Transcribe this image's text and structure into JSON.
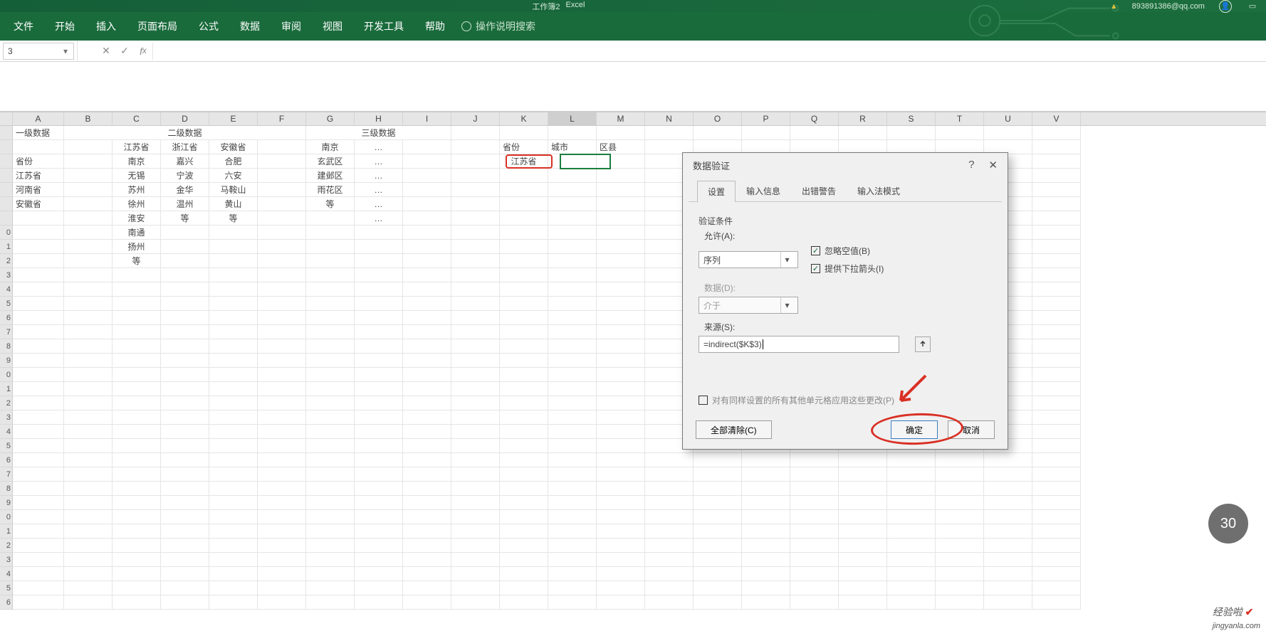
{
  "titlebar": {
    "center_1": "工作簿2",
    "center_2": "Excel",
    "email": "893891386@qq.com"
  },
  "ribbon": {
    "tabs": [
      "文件",
      "开始",
      "插入",
      "页面布局",
      "公式",
      "数据",
      "审阅",
      "视图",
      "开发工具",
      "帮助"
    ],
    "tellme": "操作说明搜索"
  },
  "fbar": {
    "namebox": "3",
    "formula": ""
  },
  "columns": [
    "A",
    "B",
    "C",
    "D",
    "E",
    "F",
    "G",
    "H",
    "I",
    "J",
    "K",
    "L",
    "M",
    "N",
    "O",
    "P",
    "Q",
    "R",
    "S",
    "T",
    "U",
    "V"
  ],
  "rows_numbers": [
    "",
    "",
    "",
    "",
    "",
    "",
    "",
    "0",
    "1",
    "2",
    "3",
    "4",
    "5",
    "6",
    "7",
    "8",
    "9",
    "0",
    "1",
    "2",
    "3",
    "4",
    "5",
    "6",
    "7",
    "8",
    "9",
    "0",
    "1",
    "2",
    "3",
    "4",
    "5",
    "6"
  ],
  "cells": {
    "r1_A": "一级数据",
    "r1_BF": "二级数据",
    "r1_GI": "三级数据",
    "r2_C": "江苏省",
    "r2_D": "浙江省",
    "r2_E": "安徽省",
    "r2_G": "南京",
    "r2_H": "…",
    "r2_K": "省份",
    "r2_L": "城市",
    "r2_M": "区县",
    "r3_A": "省份",
    "r3_C": "南京",
    "r3_D": "嘉兴",
    "r3_E": "合肥",
    "r3_G": "玄武区",
    "r3_H": "…",
    "r3_K": "江苏省",
    "r4_A": "江苏省",
    "r4_C": "无锡",
    "r4_D": "宁波",
    "r4_E": "六安",
    "r4_G": "建邺区",
    "r4_H": "…",
    "r5_A": "河南省",
    "r5_C": "苏州",
    "r5_D": "金华",
    "r5_E": "马鞍山",
    "r5_G": "雨花区",
    "r5_H": "…",
    "r6_A": "安徽省",
    "r6_C": "徐州",
    "r6_D": "温州",
    "r6_E": "黄山",
    "r6_G": "等",
    "r6_H": "…",
    "r7_C": "淮安",
    "r7_D": "等",
    "r7_E": "等",
    "r7_H": "…",
    "r8_C": "南通",
    "r9_C": "扬州",
    "r10_C": "等"
  },
  "dialog": {
    "title": "数据验证",
    "help": "?",
    "close": "✕",
    "tabs": [
      "设置",
      "输入信息",
      "出错警告",
      "输入法模式"
    ],
    "cond_label": "验证条件",
    "allow_label": "允许(A):",
    "allow_value": "序列",
    "ignore_blank": "忽略空值(B)",
    "dropdown": "提供下拉箭头(I)",
    "data_label": "数据(D):",
    "data_value": "介于",
    "source_label": "来源(S):",
    "source_value": "=indirect($K$3)",
    "apply_others": "对有同样设置的所有其他单元格应用这些更改(P)",
    "clear": "全部清除(C)",
    "ok": "确定",
    "cancel": "取消"
  },
  "misc": {
    "gray_circle": "30",
    "watermark_text": "经验啦",
    "watermark_url": "jingyanla.com"
  }
}
